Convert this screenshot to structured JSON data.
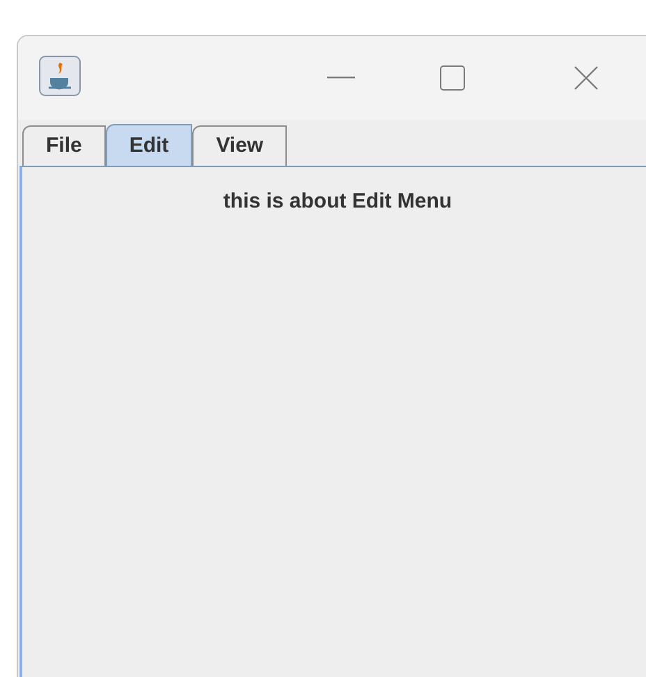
{
  "tabs": [
    {
      "label": "File",
      "selected": false
    },
    {
      "label": "Edit",
      "selected": true
    },
    {
      "label": "View",
      "selected": false
    }
  ],
  "panel": {
    "text": "this is about Edit Menu"
  }
}
